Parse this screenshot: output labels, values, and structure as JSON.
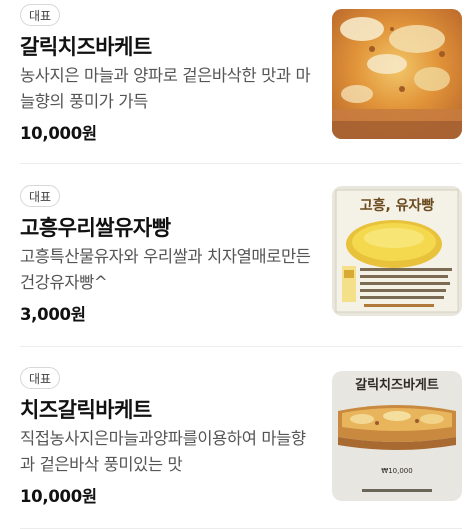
{
  "menu": {
    "items": [
      {
        "badge": "대표",
        "name": "갈릭치즈바케트",
        "description": "농사지은 마늘과 양파로 겉은바삭한 맛과 마늘향의 풍미가 가득",
        "price": "10,000원",
        "image_icon": "garlic-cheese-baguette-photo"
      },
      {
        "badge": "대표",
        "name": "고흥우리쌀유자빵",
        "description": "고흥특산물유자와 우리쌀과 치자열매로만든 건강유자빵^",
        "price": "3,000원",
        "image_icon": "yuja-bread-photo",
        "image_text": "고흥, 유자빵"
      },
      {
        "badge": "대표",
        "name": "치즈갈릭바케트",
        "description": "직접농사지은마늘과양파를이용하여 마늘향과 겉은바삭 풍미있는 맛",
        "price": "10,000원",
        "image_icon": "cheese-garlic-baguette-photo",
        "image_text": "갈릭치즈바게트",
        "image_price": "₩10,000"
      }
    ]
  }
}
